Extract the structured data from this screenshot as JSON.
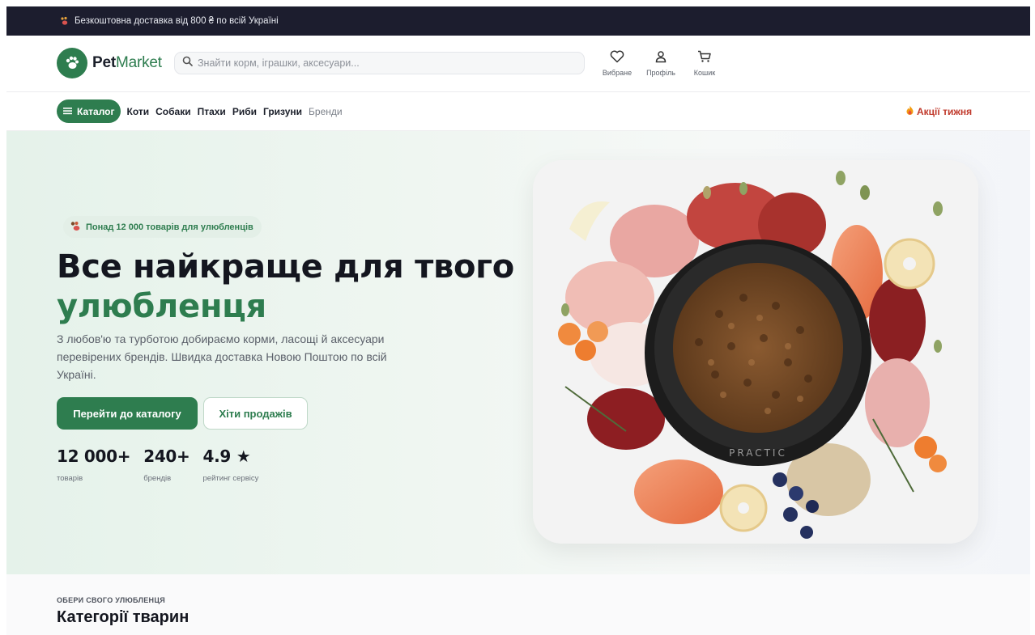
{
  "topbar": {
    "icon": "paw-icon",
    "text": "Безкоштовна доставка від 800 ₴ по всій Україні"
  },
  "header": {
    "logo": {
      "part1": "Pet",
      "part2": "Market",
      "icon": "paw-icon"
    },
    "search": {
      "placeholder": "Знайти корм, іграшки, аксесуари..."
    },
    "actions": [
      {
        "icon": "heart-icon",
        "label": "Вибране"
      },
      {
        "icon": "user-icon",
        "label": "Профіль"
      },
      {
        "icon": "cart-icon",
        "label": "Кошик"
      }
    ]
  },
  "nav": {
    "catalog_label": "Каталог",
    "items": [
      "Коти",
      "Собаки",
      "Птахи",
      "Риби",
      "Гризуни",
      "Бренди"
    ],
    "promo": "Акції тижня"
  },
  "hero": {
    "badge": "Понад 12 000 товарів для улюбленців",
    "title_line1": "Все найкраще для твого",
    "title_line2": "улюбленця",
    "subtitle": "З любов'ю та турботою добираємо корми, ласощі й аксесуари перевірених брендів. Швидка доставка Новою Поштою по всій Україні.",
    "primary_button": "Перейти до каталогу",
    "secondary_button": "Хіти продажів",
    "stats": [
      {
        "value": "12 000+",
        "caption": "товарів"
      },
      {
        "value": "240+",
        "caption": "брендів"
      },
      {
        "value": "4.9 ★",
        "caption": "рейтинг сервісу"
      }
    ],
    "image_bowl_text": "PRACTIC"
  },
  "categories": {
    "kicker": "ОБЕРИ СВОГО УЛЮБЛЕНЦЯ",
    "title": "Категорії тварин"
  },
  "colors": {
    "brand": "#2e7d4f",
    "dark": "#1c1d2e",
    "promo": "#c0392b"
  }
}
